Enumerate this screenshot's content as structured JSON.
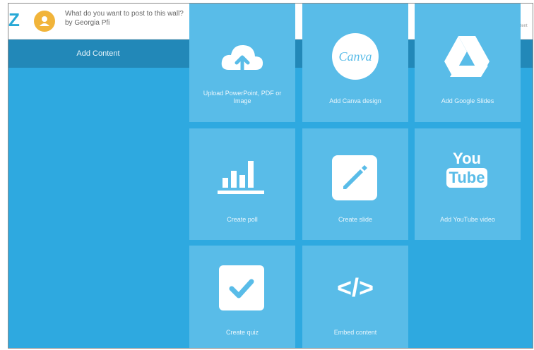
{
  "header": {
    "logo_text": "Z",
    "title": "What do you want to post to this wall?",
    "subtitle": "by Georgia Pfi",
    "add_label": "Add Content"
  },
  "sidebar": {
    "header": "Add Content"
  },
  "tiles": [
    {
      "label": "Upload PowerPoint, PDF or Image",
      "icon": "cloud-upload-icon"
    },
    {
      "label": "Add Canva design",
      "icon": "canva-icon",
      "badge": "Canva"
    },
    {
      "label": "Add Google Slides",
      "icon": "google-drive-icon"
    },
    {
      "label": "Create poll",
      "icon": "bar-chart-icon"
    },
    {
      "label": "Create slide",
      "icon": "pencil-icon"
    },
    {
      "label": "Add YouTube video",
      "icon": "youtube-icon",
      "badge_top": "You",
      "badge_bottom": "Tube"
    },
    {
      "label": "Create quiz",
      "icon": "checkmark-icon"
    },
    {
      "label": "Embed content",
      "icon": "code-icon",
      "glyph": "</>"
    }
  ],
  "colors": {
    "background": "#2ea9e0",
    "band": "#2288b8",
    "tile": "#59bce8",
    "avatar": "#f1b43a",
    "accent": "#1a98d0"
  }
}
